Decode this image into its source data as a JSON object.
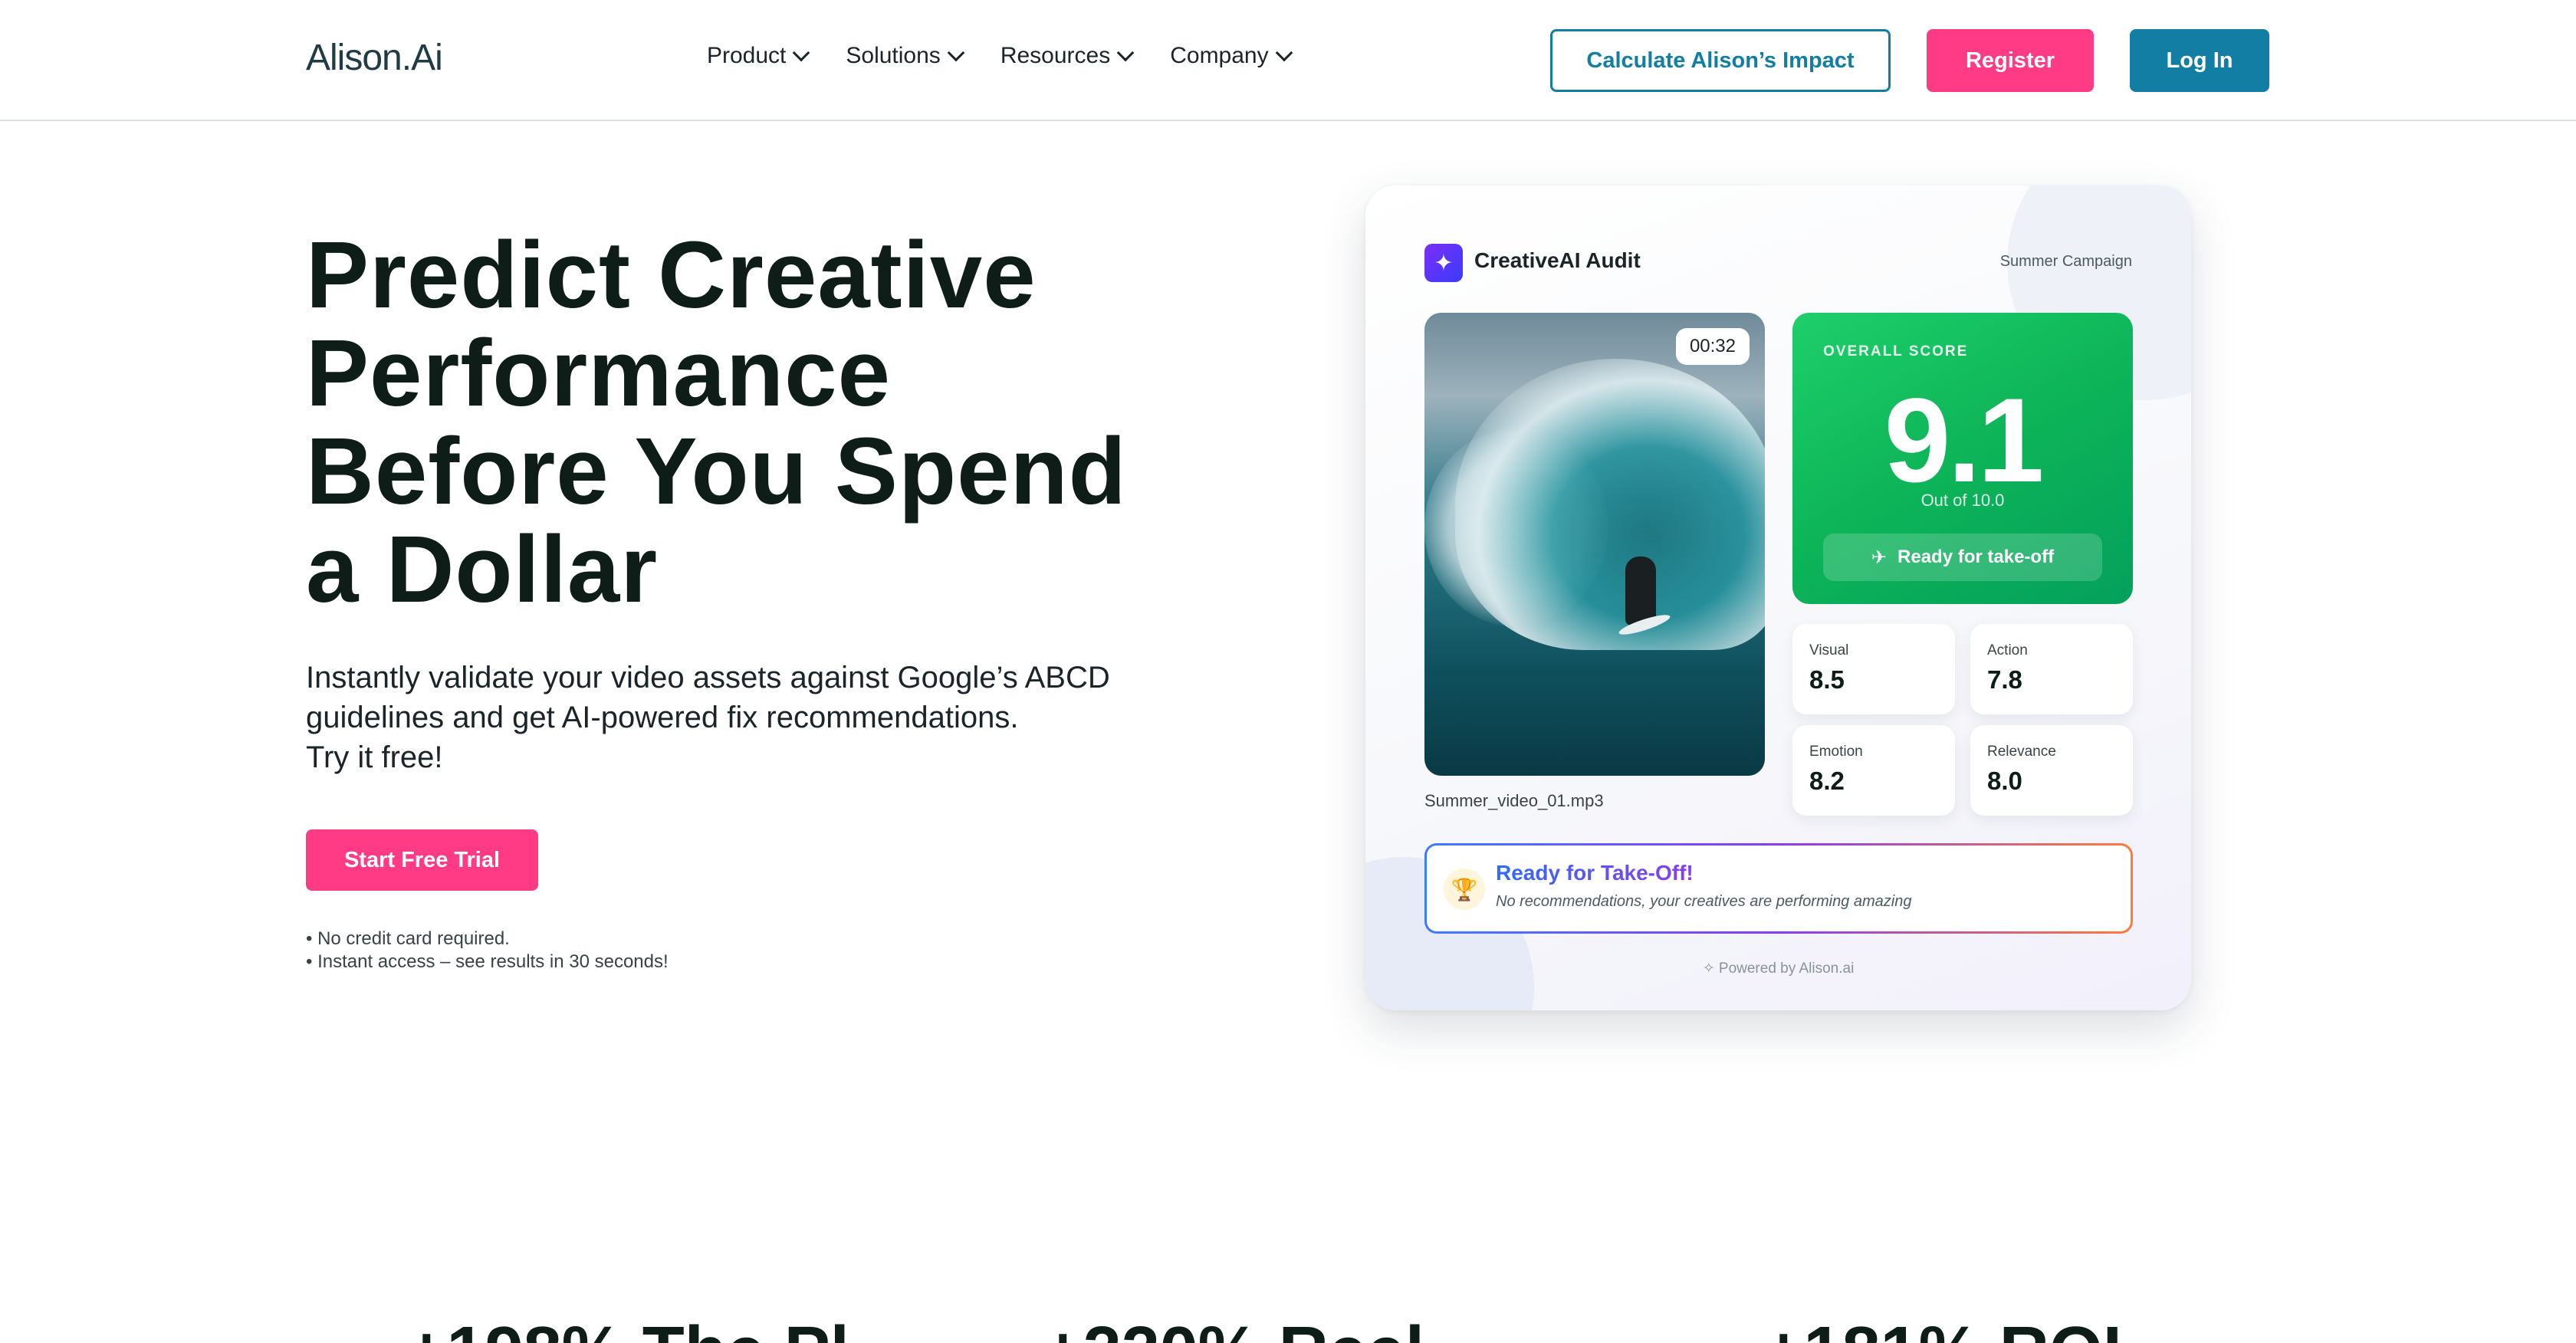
{
  "header": {
    "logo": "Alison.Ai",
    "nav": [
      {
        "label": "Product"
      },
      {
        "label": "Solutions"
      },
      {
        "label": "Resources"
      },
      {
        "label": "Company"
      }
    ],
    "impact_label": "Calculate Alison’s Impact",
    "register_label": "Register",
    "login_label": "Log In",
    "colors": {
      "primary": "#137ea3",
      "accent": "#ff3b85"
    }
  },
  "hero": {
    "title": "Predict Creative Performance Before You Spend a Dollar",
    "subtitle_lines": [
      "Instantly validate your video assets against Google’s ABCD",
      "guidelines and get AI-powered fix recommendations.",
      "Try it free!"
    ],
    "cta_label": "Start Free Trial",
    "notes": [
      "• No credit card required.",
      "• Instant access – see results in 30 seconds!"
    ]
  },
  "audit_card": {
    "title": "CreativeAI Audit",
    "campaign": "Summer Campaign",
    "video": {
      "timer": "00:32",
      "filename": "Summer_video_01.mp3"
    },
    "score": {
      "label": "OVERALL SCORE",
      "value": "9.1",
      "out_of": "Out of 10.0",
      "status": "Ready for take-off",
      "color": "#0db458"
    },
    "metrics": [
      {
        "label": "Visual",
        "value": "8.5"
      },
      {
        "label": "Action",
        "value": "7.8"
      },
      {
        "label": "Emotion",
        "value": "8.2"
      },
      {
        "label": "Relevance",
        "value": "8.0"
      }
    ],
    "takeoff": {
      "title": "Ready for Take-Off!",
      "subtitle": "No recommendations, your creatives are performing amazing"
    },
    "powered_by": "Powered by Alison.ai",
    "icons": [
      "sparkle-icon",
      "trophy-icon",
      "plane-takeoff-icon"
    ]
  },
  "stats": [
    {
      "text": "+198% The Pl"
    },
    {
      "text": "+220% Reel"
    },
    {
      "text": "+181% ROI"
    }
  ]
}
